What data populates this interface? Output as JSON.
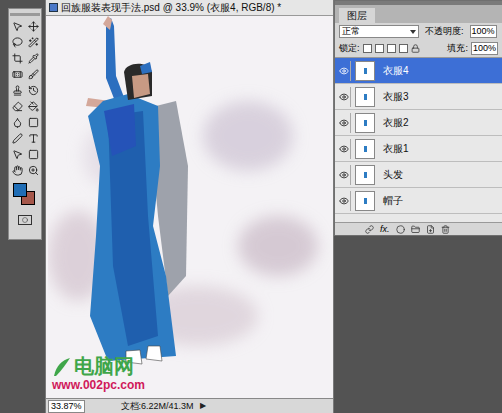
{
  "document": {
    "title": "回族服装表现手法.psd @ 33.9% (衣服4, RGB/8) *",
    "zoom": "33.87%",
    "doc_info": "文档:6.22M/41.3M",
    "arrow": "▶"
  },
  "swatches": [
    {
      "color": "#1f6db5"
    },
    {
      "color": "#a5574a"
    }
  ],
  "layers_panel": {
    "tab": "图层",
    "blend_mode": "正常",
    "opacity_label": "不透明度:",
    "opacity": "100%",
    "lock_label": "锁定:",
    "fill_label": "填充:",
    "fill": "100%",
    "layers": [
      {
        "name": "衣服4",
        "selected": true,
        "visible": true
      },
      {
        "name": "衣服3",
        "selected": false,
        "visible": true
      },
      {
        "name": "衣服2",
        "selected": false,
        "visible": true
      },
      {
        "name": "衣服1",
        "selected": false,
        "visible": true
      },
      {
        "name": "头发",
        "selected": false,
        "visible": true
      },
      {
        "name": "帽子",
        "selected": false,
        "visible": true
      }
    ],
    "footer_label": "fx."
  },
  "watermark": {
    "site": "电脑网",
    "url": "www.002pc.com"
  }
}
